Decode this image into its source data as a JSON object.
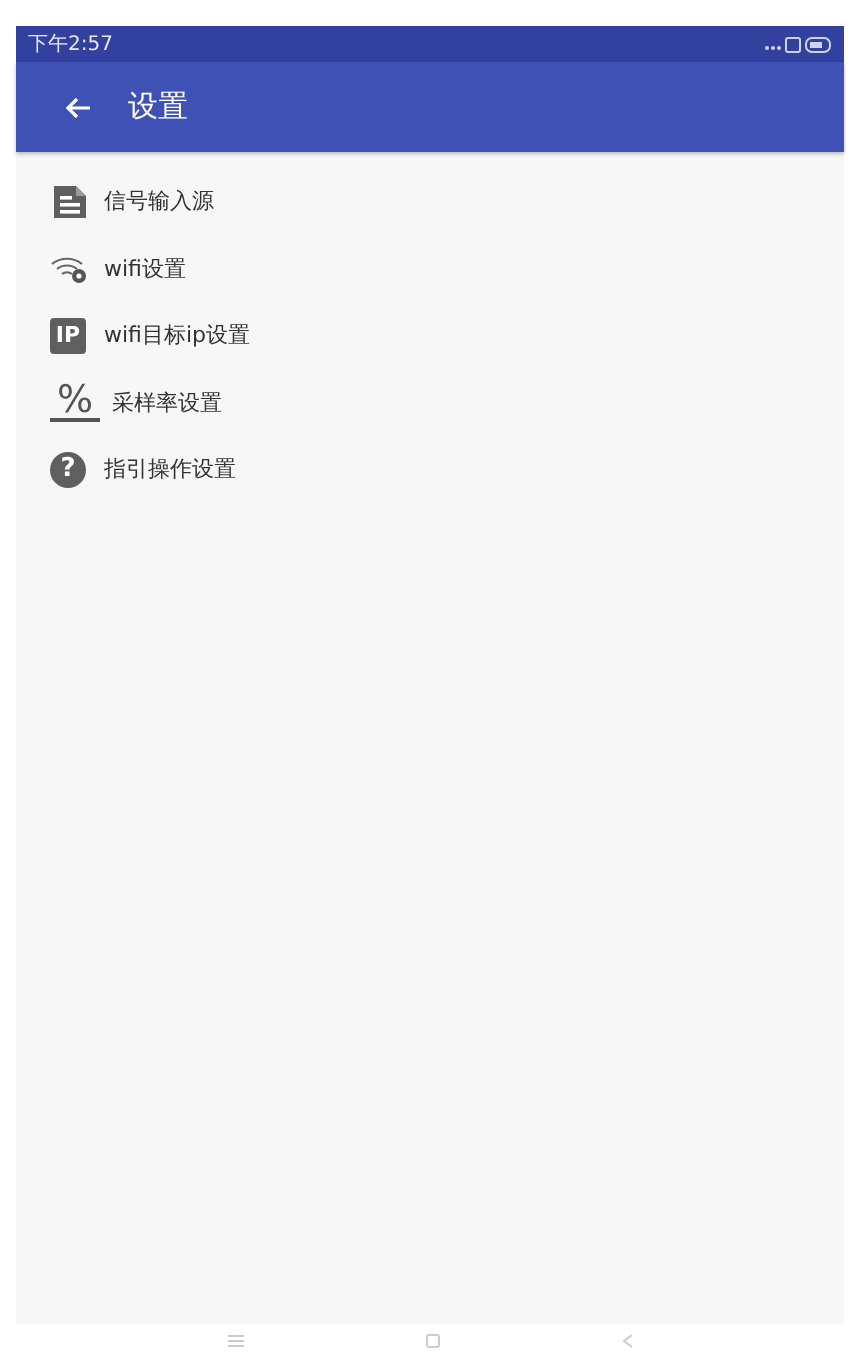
{
  "status_bar": {
    "time": "下午2:57"
  },
  "toolbar": {
    "title": "设置"
  },
  "items": [
    {
      "kind": "document",
      "label": "信号输入源"
    },
    {
      "kind": "wifi",
      "label": "wifi设置"
    },
    {
      "kind": "badge",
      "icon_text": "IP",
      "label": "wifi目标ip设置"
    },
    {
      "kind": "percent",
      "icon_text": "%",
      "label": "采样率设置"
    },
    {
      "kind": "help",
      "icon_text": "?",
      "label": "指引操作设置"
    }
  ]
}
